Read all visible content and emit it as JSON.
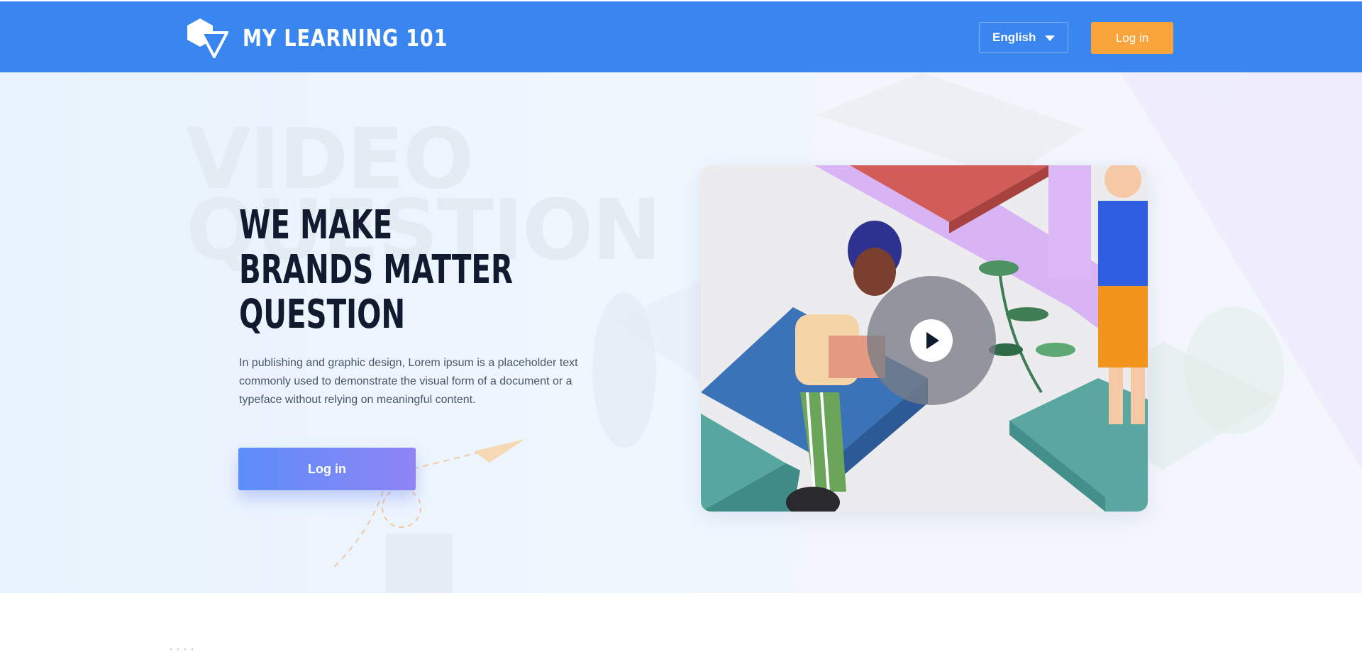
{
  "header": {
    "brand": "MY LEARNING 101",
    "language": "English",
    "login_label": "Log in"
  },
  "hero": {
    "watermark_line1": "VIDEO",
    "watermark_line2": "QUESTION",
    "headline": [
      "WE MAKE",
      "BRANDS MATTER",
      "QUESTION"
    ],
    "description": "In publishing and graphic design, Lorem ipsum is a placeholder text commonly used to demonstrate the visual form of a document or a typeface without relying on meaningful content.",
    "cta_label": "Log in"
  },
  "colors": {
    "header_bg": "#3a86f1",
    "accent_orange": "#f8a43a",
    "cta_gradient_start": "#5b8ef9",
    "cta_gradient_end": "#8f84f5",
    "headline": "#121a30"
  },
  "icons": {
    "logo": "logo-hexagon-triangle-icon",
    "language_caret": "caret-down-icon",
    "video_play": "play-icon"
  }
}
